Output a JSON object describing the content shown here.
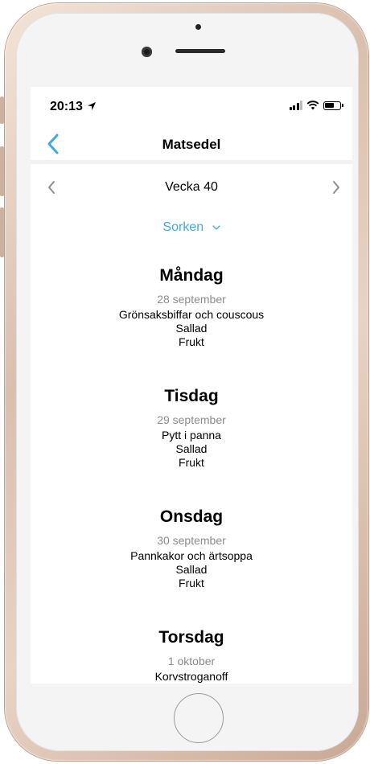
{
  "status_bar": {
    "time": "20:13"
  },
  "nav": {
    "title": "Matsedel"
  },
  "week": {
    "label": "Vecka 40"
  },
  "location": {
    "selected": "Sorken"
  },
  "days": [
    {
      "name": "Måndag",
      "date": "28 september",
      "dishes": [
        "Grönsaksbiffar och couscous",
        "Sallad",
        "Frukt"
      ]
    },
    {
      "name": "Tisdag",
      "date": "29 september",
      "dishes": [
        "Pytt i panna",
        "Sallad",
        "Frukt"
      ]
    },
    {
      "name": "Onsdag",
      "date": "30 september",
      "dishes": [
        "Pannkakor och ärtsoppa",
        "Sallad",
        "Frukt"
      ]
    },
    {
      "name": "Torsdag",
      "date": "1 oktober",
      "dishes": [
        "Korvstroganoff"
      ]
    }
  ],
  "colors": {
    "accent": "#3fa9e0",
    "date_gray": "#8c8c8c",
    "chevron_gray": "#8e8e93"
  },
  "icons": {
    "back": "chevron-left-icon",
    "prev": "chevron-left-icon",
    "next": "chevron-right-icon",
    "dropdown": "chevron-down-icon",
    "location": "location-arrow-icon"
  }
}
